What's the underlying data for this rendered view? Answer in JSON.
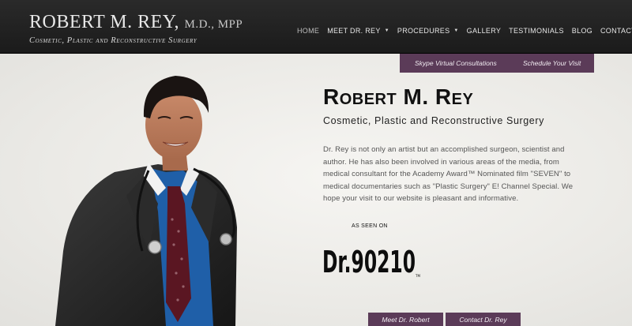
{
  "header": {
    "name": "ROBERT M. REY,",
    "credentials": "M.D., MPP",
    "tagline": "Cosmetic, Plastic and Reconstructive Surgery"
  },
  "nav": {
    "items": [
      {
        "label": "HOME",
        "active": true,
        "dropdown": false
      },
      {
        "label": "MEET DR. REY",
        "active": false,
        "dropdown": true
      },
      {
        "label": "PROCEDURES",
        "active": false,
        "dropdown": true
      },
      {
        "label": "GALLERY",
        "active": false,
        "dropdown": false
      },
      {
        "label": "TESTIMONIALS",
        "active": false,
        "dropdown": false
      },
      {
        "label": "BLOG",
        "active": false,
        "dropdown": false
      },
      {
        "label": "CONTACT",
        "active": false,
        "dropdown": true
      }
    ],
    "caret_glyph": "▼"
  },
  "top_cta": {
    "skype": "Skype Virtual Consultations",
    "schedule": "Schedule Your Visit"
  },
  "hero": {
    "title": "Robert M. Rey",
    "subtitle": "Cosmetic, Plastic and Reconstructive Surgery",
    "bio": "Dr. Rey is not only an artist but an accomplished surgeon, scientist and author. He has also been involved in various areas of the media, from medical consultant for the Academy Award™ Nominated film \"SEVEN\" to medical documentaries such as \"Plastic Surgery\" E! Channel Special. We hope your visit to our website is pleasant and informative.",
    "as_seen_on": "AS SEEN ON",
    "show_logo_text": "Dr.90210",
    "show_logo_tm": "TM"
  },
  "buttons": {
    "meet": "Meet Dr. Robert",
    "contact": "Contact Dr. Rey"
  },
  "colors": {
    "header_bg": "#1b1b1b",
    "accent_purple": "#5b3b58",
    "page_bg": "#ecebe8"
  }
}
